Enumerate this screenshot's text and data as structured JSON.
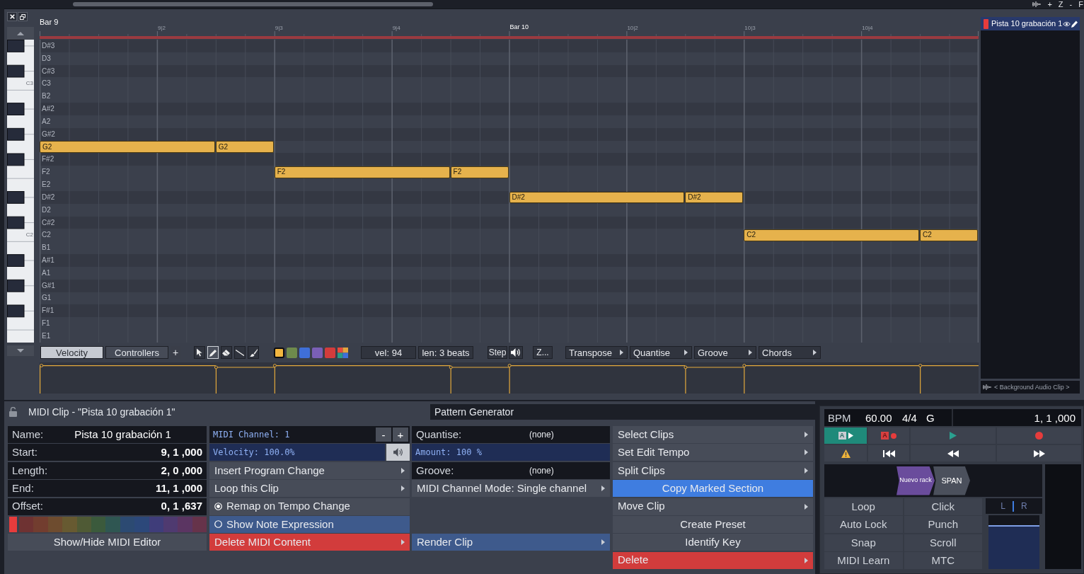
{
  "top_bar": {
    "controls": [
      "+",
      "Z",
      "-",
      "F"
    ]
  },
  "editor": {
    "ruler": {
      "current_bar": "Bar 9",
      "marks": [
        {
          "label": "9|2",
          "kind": "beat"
        },
        {
          "label": "9|3",
          "kind": "beat"
        },
        {
          "label": "9|4",
          "kind": "beat"
        },
        {
          "label": "Bar 10",
          "kind": "bar"
        },
        {
          "label": "10|2",
          "kind": "beat"
        },
        {
          "label": "10|3",
          "kind": "beat"
        },
        {
          "label": "10|4",
          "kind": "beat"
        }
      ]
    },
    "rows": [
      {
        "label": "D#3",
        "kind": "sharp"
      },
      {
        "label": "D3",
        "kind": "natural"
      },
      {
        "label": "C#3",
        "kind": "sharp"
      },
      {
        "label": "C3",
        "kind": "natural",
        "key_label": "C3"
      },
      {
        "label": "B2",
        "kind": "natural"
      },
      {
        "label": "A#2",
        "kind": "sharp"
      },
      {
        "label": "A2",
        "kind": "natural"
      },
      {
        "label": "G#2",
        "kind": "sharp"
      },
      {
        "kind": "natural",
        "notes": [
          {
            "label": "G2"
          },
          {
            "label": "G2"
          }
        ]
      },
      {
        "label": "F#2",
        "kind": "sharp"
      },
      {
        "label": "F2",
        "kind": "natural",
        "notes": [
          {
            "label": "F2"
          },
          {
            "label": "F2"
          }
        ]
      },
      {
        "label": "E2",
        "kind": "natural"
      },
      {
        "label": "D#2",
        "kind": "sharp",
        "notes": [
          {
            "label": "D#2"
          },
          {
            "label": "D#2"
          }
        ]
      },
      {
        "label": "D2",
        "kind": "natural"
      },
      {
        "label": "C#2",
        "kind": "sharp"
      },
      {
        "label": "C2",
        "kind": "natural",
        "key_label": "C2",
        "notes": [
          {
            "label": "C2"
          },
          {
            "label": "C2"
          }
        ]
      },
      {
        "label": "B1",
        "kind": "natural"
      },
      {
        "label": "A#1",
        "kind": "sharp"
      },
      {
        "label": "A1",
        "kind": "natural"
      },
      {
        "label": "G#1",
        "kind": "sharp"
      },
      {
        "label": "G1",
        "kind": "natural"
      },
      {
        "label": "F#1",
        "kind": "sharp"
      },
      {
        "label": "F1",
        "kind": "natural"
      },
      {
        "label": "E1",
        "kind": "natural"
      }
    ],
    "toolbar": {
      "lane_tabs": [
        {
          "label": "Velocity",
          "selected": true
        },
        {
          "label": "Controllers",
          "selected": false
        }
      ],
      "add_lane": "+",
      "tools": [
        {
          "kind": "pointer",
          "selected": false
        },
        {
          "kind": "pencil",
          "selected": true
        },
        {
          "kind": "eraser",
          "selected": false
        },
        {
          "kind": "line",
          "selected": false
        },
        {
          "kind": "brush",
          "selected": false
        }
      ],
      "note_colors": [
        {
          "kind": "solid",
          "color": "#f2b63f",
          "selected": true
        },
        {
          "kind": "solid",
          "color": "#6e8a4c",
          "selected": false
        },
        {
          "kind": "solid",
          "color": "#3f6fd8",
          "selected": false
        },
        {
          "kind": "solid",
          "color": "#7a5fb6",
          "selected": false
        },
        {
          "kind": "solid",
          "color": "#d23c3c",
          "selected": false
        },
        {
          "kind": "multi",
          "selected": false
        }
      ],
      "velocity": "vel: 94",
      "length": "len: 3 beats",
      "step": "Step",
      "zoom": "Z...",
      "menus": [
        "Transpose",
        "Quantise",
        "Groove",
        "Chords"
      ]
    },
    "clip_list": {
      "title": "Pista 10 grabación 1",
      "color": "#e63c3c",
      "background_clip": "< Background Audio Clip >"
    }
  },
  "clip_panel": {
    "title": "MIDI Clip - \"Pista 10 grabación 1\"",
    "pattern_generator": "Pattern Generator",
    "columns": [
      [
        {
          "kind": "text",
          "label": "Name:",
          "value": "Pista 10 grabación 1"
        },
        {
          "kind": "time",
          "label": "Start:",
          "value": "9, 1 ,000"
        },
        {
          "kind": "time",
          "label": "Length:",
          "value": "2, 0 ,000"
        },
        {
          "kind": "time",
          "label": "End:",
          "value": "11, 1 ,000"
        },
        {
          "kind": "time",
          "label": "Offset:",
          "value": "0, 1 ,637"
        },
        {
          "kind": "palette",
          "color": "#e63c3c",
          "swatches": [
            {
              "color": "#6e3232"
            },
            {
              "color": "#723d2f"
            },
            {
              "color": "#6e4c2f"
            },
            {
              "color": "#675a31"
            },
            {
              "color": "#4f5a35"
            },
            {
              "color": "#3b5a3c"
            },
            {
              "color": "#2f5652"
            },
            {
              "color": "#2c4a72"
            },
            {
              "color": "#2c487a"
            },
            {
              "color": "#3f3d7a"
            },
            {
              "color": "#4f3a70"
            },
            {
              "color": "#5b3562"
            },
            {
              "color": "#66334a"
            }
          ]
        },
        {
          "kind": "menu",
          "label": "Show/Hide MIDI Editor",
          "submenu": false
        }
      ],
      [
        {
          "kind": "stepper",
          "label": "MIDI Channel: 1",
          "buttons": [
            "-",
            "+"
          ]
        },
        {
          "kind": "slider",
          "label": "Velocity: 100.0%",
          "level": 1,
          "preview_button": true
        },
        {
          "kind": "menu",
          "label": "Insert Program Change",
          "submenu": true
        },
        {
          "kind": "menu",
          "label": "Loop this Clip",
          "submenu": true
        },
        {
          "kind": "radio",
          "label": "Remap on Tempo Change",
          "checked": true,
          "highlighted": false
        },
        {
          "kind": "radio",
          "label": "Show Note Expression",
          "checked": false,
          "highlighted": true
        },
        {
          "kind": "danger",
          "label": "Delete MIDI Content",
          "submenu": true
        }
      ],
      [
        {
          "kind": "field",
          "label": "Quantise:",
          "value": "(none)"
        },
        {
          "kind": "slider",
          "label": "Amount: 100 %",
          "level": 1,
          "preview_button": false
        },
        {
          "kind": "field",
          "label": "Groove:",
          "value": "(none)"
        },
        {
          "kind": "menu",
          "label": "MIDI Channel Mode: Single channel",
          "submenu": true
        },
        {
          "kind": "accent",
          "label": "Render Clip",
          "submenu": true
        }
      ],
      [
        {
          "kind": "menu",
          "label": "Select Clips",
          "submenu": true
        },
        {
          "kind": "menu",
          "label": "Set Edit Tempo",
          "submenu": true
        },
        {
          "kind": "menu",
          "label": "Split Clips",
          "submenu": true
        },
        {
          "kind": "primary",
          "label": "Copy Marked Section",
          "submenu": false
        },
        {
          "kind": "menu",
          "label": "Move Clip",
          "submenu": true
        },
        {
          "kind": "menu",
          "label": "Create Preset",
          "submenu": false
        },
        {
          "kind": "menu",
          "label": "Identify Key",
          "submenu": false
        },
        {
          "kind": "danger",
          "label": "Delete",
          "submenu": true
        }
      ]
    ]
  },
  "transport": {
    "display": {
      "bpm_label": "BPM",
      "bpm": "60.00",
      "time_signature": "4/4",
      "key": "G",
      "position": "1, 1 ,000"
    },
    "buttons": [
      {
        "kind": "auto-play",
        "badge": "A",
        "on": true
      },
      {
        "kind": "auto-record",
        "badge": "A",
        "on": false
      },
      {
        "kind": "play",
        "on": false
      },
      {
        "kind": "record",
        "on": false
      },
      {
        "kind": "warning",
        "on": false
      },
      {
        "kind": "to-start",
        "on": false
      },
      {
        "kind": "rewind",
        "on": false
      },
      {
        "kind": "fast-forward",
        "on": false
      }
    ],
    "rack": [
      {
        "label": "Nuevo rack",
        "color": "#6a4c9c"
      },
      {
        "label": "SPAN",
        "color": "#4b505c"
      }
    ],
    "toggles": [
      "Loop",
      "Click",
      "Auto Lock",
      "Punch",
      "Snap",
      "Scroll",
      "MIDI Learn",
      "MTC"
    ],
    "meter": {
      "left": "L",
      "right": "R",
      "level": 0.82
    }
  }
}
